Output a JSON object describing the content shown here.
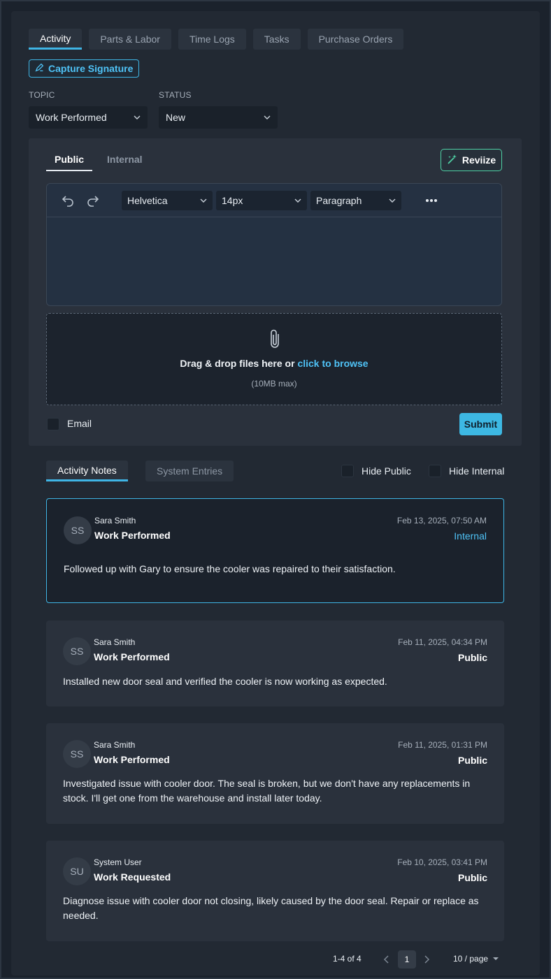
{
  "tabs": [
    "Activity",
    "Parts & Labor",
    "Time Logs",
    "Tasks",
    "Purchase Orders"
  ],
  "capture_signature": "Capture Signature",
  "topic": {
    "label": "TOPIC",
    "value": "Work Performed"
  },
  "status": {
    "label": "STATUS",
    "value": "New"
  },
  "composer": {
    "tabs": [
      "Public",
      "Internal"
    ],
    "reviize": "Reviize",
    "font": "Helvetica",
    "size": "14px",
    "block": "Paragraph",
    "dropzone_text": "Drag & drop files here or ",
    "dropzone_link": "click to browse",
    "dropzone_max": "(10MB max)",
    "email_label": "Email",
    "submit": "Submit"
  },
  "notes_tabs": [
    "Activity Notes",
    "System Entries"
  ],
  "filters": [
    "Hide Public",
    "Hide Internal"
  ],
  "notes": [
    {
      "initials": "SS",
      "author": "Sara Smith",
      "topic": "Work Performed",
      "date": "Feb 13, 2025, 07:50 AM",
      "visibility": "Internal",
      "body": "Followed up with Gary to ensure the cooler was repaired to their satisfaction."
    },
    {
      "initials": "SS",
      "author": "Sara Smith",
      "topic": "Work Performed",
      "date": "Feb 11, 2025, 04:34 PM",
      "visibility": "Public",
      "body": "Installed new door seal and verified the cooler is now working as expected."
    },
    {
      "initials": "SS",
      "author": "Sara Smith",
      "topic": "Work Performed",
      "date": "Feb 11, 2025, 01:31 PM",
      "visibility": "Public",
      "body": "Investigated issue with cooler door. The seal is broken, but we don't have any replacements in stock. I'll get one from the warehouse and install later today."
    },
    {
      "initials": "SU",
      "author": "System User",
      "topic": "Work Requested",
      "date": "Feb 10, 2025, 03:41 PM",
      "visibility": "Public",
      "body": "Diagnose issue with cooler door not closing, likely caused by the door seal. Repair or replace as needed."
    }
  ],
  "pagination": {
    "range": "1-4 of 4",
    "page": "1",
    "per_page": "10 / page"
  },
  "colors": {
    "accent": "#3fb5e5",
    "reviize_border": "#4fd1a5"
  }
}
